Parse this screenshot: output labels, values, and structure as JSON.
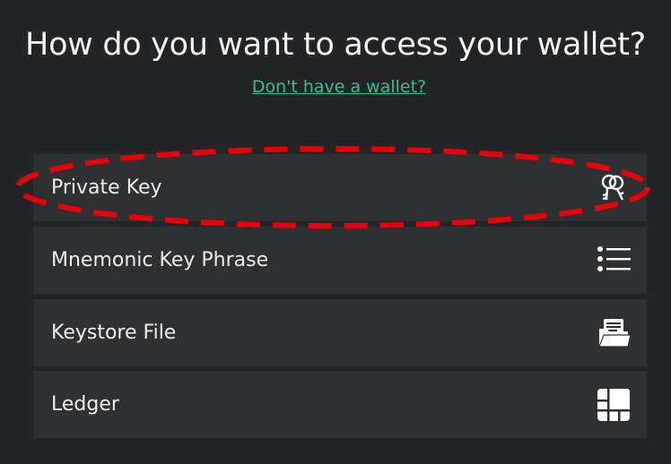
{
  "heading": "How do you want to access your wallet?",
  "no_wallet_link": "Don't have a wallet?",
  "options": [
    {
      "label": "Private Key",
      "icon": "keys-icon"
    },
    {
      "label": "Mnemonic Key Phrase",
      "icon": "list-icon"
    },
    {
      "label": "Keystore File",
      "icon": "folder-file-icon"
    },
    {
      "label": "Ledger",
      "icon": "ledger-icon"
    }
  ],
  "highlight": {
    "target": "Private Key",
    "color": "#e8000b",
    "style": "dashed-ellipse"
  }
}
